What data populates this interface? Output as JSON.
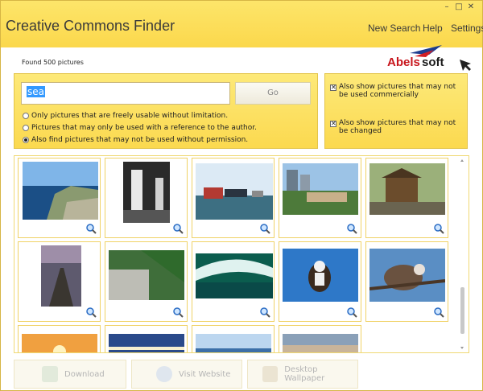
{
  "app": {
    "title": "Creative Commons Finder"
  },
  "window_controls": {
    "minimize": "–",
    "maximize": "□",
    "close": "✕"
  },
  "nav": {
    "new_search": "New Search",
    "help": "Help",
    "settings": "Settings"
  },
  "status": {
    "found": "Found 500 pictures"
  },
  "logo": {
    "text": "Abelssoft"
  },
  "search": {
    "value": "sea",
    "go_label": "Go"
  },
  "radios": [
    {
      "label": "Only pictures that are freely usable without limitation.",
      "selected": false
    },
    {
      "label": "Pictures that may only be used with a reference to the author.",
      "selected": false
    },
    {
      "label": "Also find pictures that may not be used without permission.",
      "selected": true
    }
  ],
  "checks": [
    {
      "label": "Also show pictures that may not be used commercially",
      "checked": true
    },
    {
      "label": "Also show pictures that may not be changed",
      "checked": true
    }
  ],
  "gallery": {
    "rows": [
      [
        {
          "name": "sea-cliff-coast"
        },
        {
          "name": "lighthouse-bw"
        },
        {
          "name": "harbor-ships"
        },
        {
          "name": "city-waterfront"
        },
        {
          "name": "japanese-pavilion"
        }
      ],
      [
        {
          "name": "pier-sunset"
        },
        {
          "name": "stone-wall-tree"
        },
        {
          "name": "ocean-wave"
        },
        {
          "name": "osprey-fish"
        },
        {
          "name": "osprey-branch"
        }
      ],
      [
        {
          "name": "sunset-sea"
        },
        {
          "name": "pier-lights"
        },
        {
          "name": "beach-city"
        },
        {
          "name": "flea-market"
        }
      ]
    ]
  },
  "actions": {
    "download": "Download",
    "visit": "Visit Website",
    "wallpaper": "Desktop Wallpaper"
  },
  "colors": {
    "accent": "#fbd84c",
    "border": "#f0d266"
  }
}
